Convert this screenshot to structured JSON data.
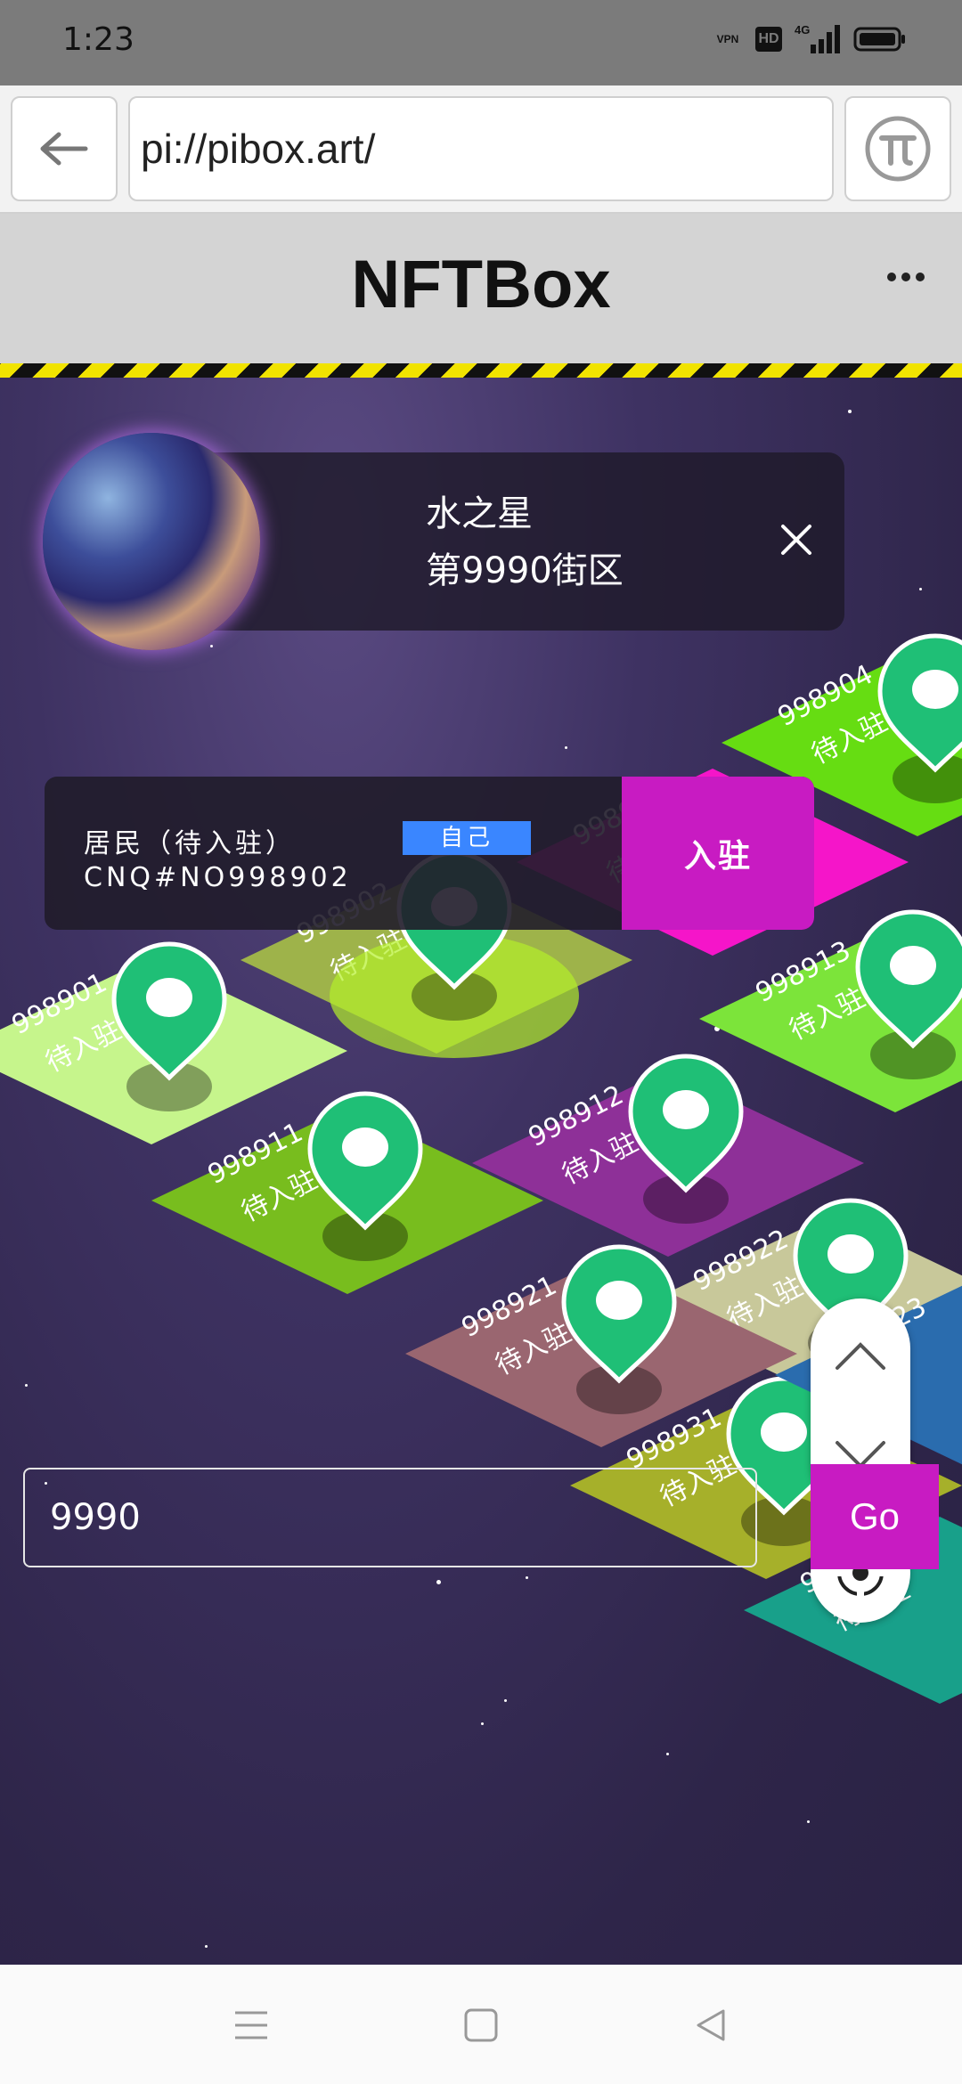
{
  "status_bar": {
    "time": "1:23",
    "vpn": "VPN",
    "hd": "HD",
    "network": "4G"
  },
  "browser": {
    "url": "pi://pibox.art/"
  },
  "app": {
    "title": "NFTBox"
  },
  "planet": {
    "name": "水之星",
    "block": "第9990街区"
  },
  "resident": {
    "label": "居民（待入驻）",
    "badge": "自己",
    "id": "CNQ#NO998902",
    "action": "入驻"
  },
  "plots": [
    {
      "id": "998904",
      "status": "待入驻",
      "color": "#66dd12"
    },
    {
      "id": "998903",
      "status": "待入驻",
      "color": "#f515c9"
    },
    {
      "id": "998902",
      "status": "待入驻",
      "color": "#9eb34a"
    },
    {
      "id": "998913",
      "status": "待入驻",
      "color": "#7ce43a"
    },
    {
      "id": "998901",
      "status": "待入驻",
      "color": "#c6f58c"
    },
    {
      "id": "998912",
      "status": "待入驻",
      "color": "#8e3098"
    },
    {
      "id": "998911",
      "status": "待入驻",
      "color": "#78bd1e"
    },
    {
      "id": "998922",
      "status": "待入驻",
      "color": "#c8c89a"
    },
    {
      "id": "998921",
      "status": "待入驻",
      "color": "#9a6670"
    },
    {
      "id": "998931",
      "status": "待入驻",
      "color": "#a6b02a"
    },
    {
      "id": "998932",
      "status": "待入驻",
      "color": "#18a08a"
    },
    {
      "id": "998923",
      "status": "",
      "color": "#2a6cae"
    }
  ],
  "search": {
    "value": "9990",
    "go_label": "Go"
  },
  "colors": {
    "accent": "#c81bc2",
    "pin": "#1fbf76",
    "badge": "#3a86ff"
  },
  "icons": [
    "back-arrow-icon",
    "pi-logo-icon",
    "more-icon",
    "close-icon",
    "chevron-up-icon",
    "chevron-down-icon",
    "locate-icon",
    "menu-icon",
    "home-icon",
    "back-triangle-icon"
  ]
}
